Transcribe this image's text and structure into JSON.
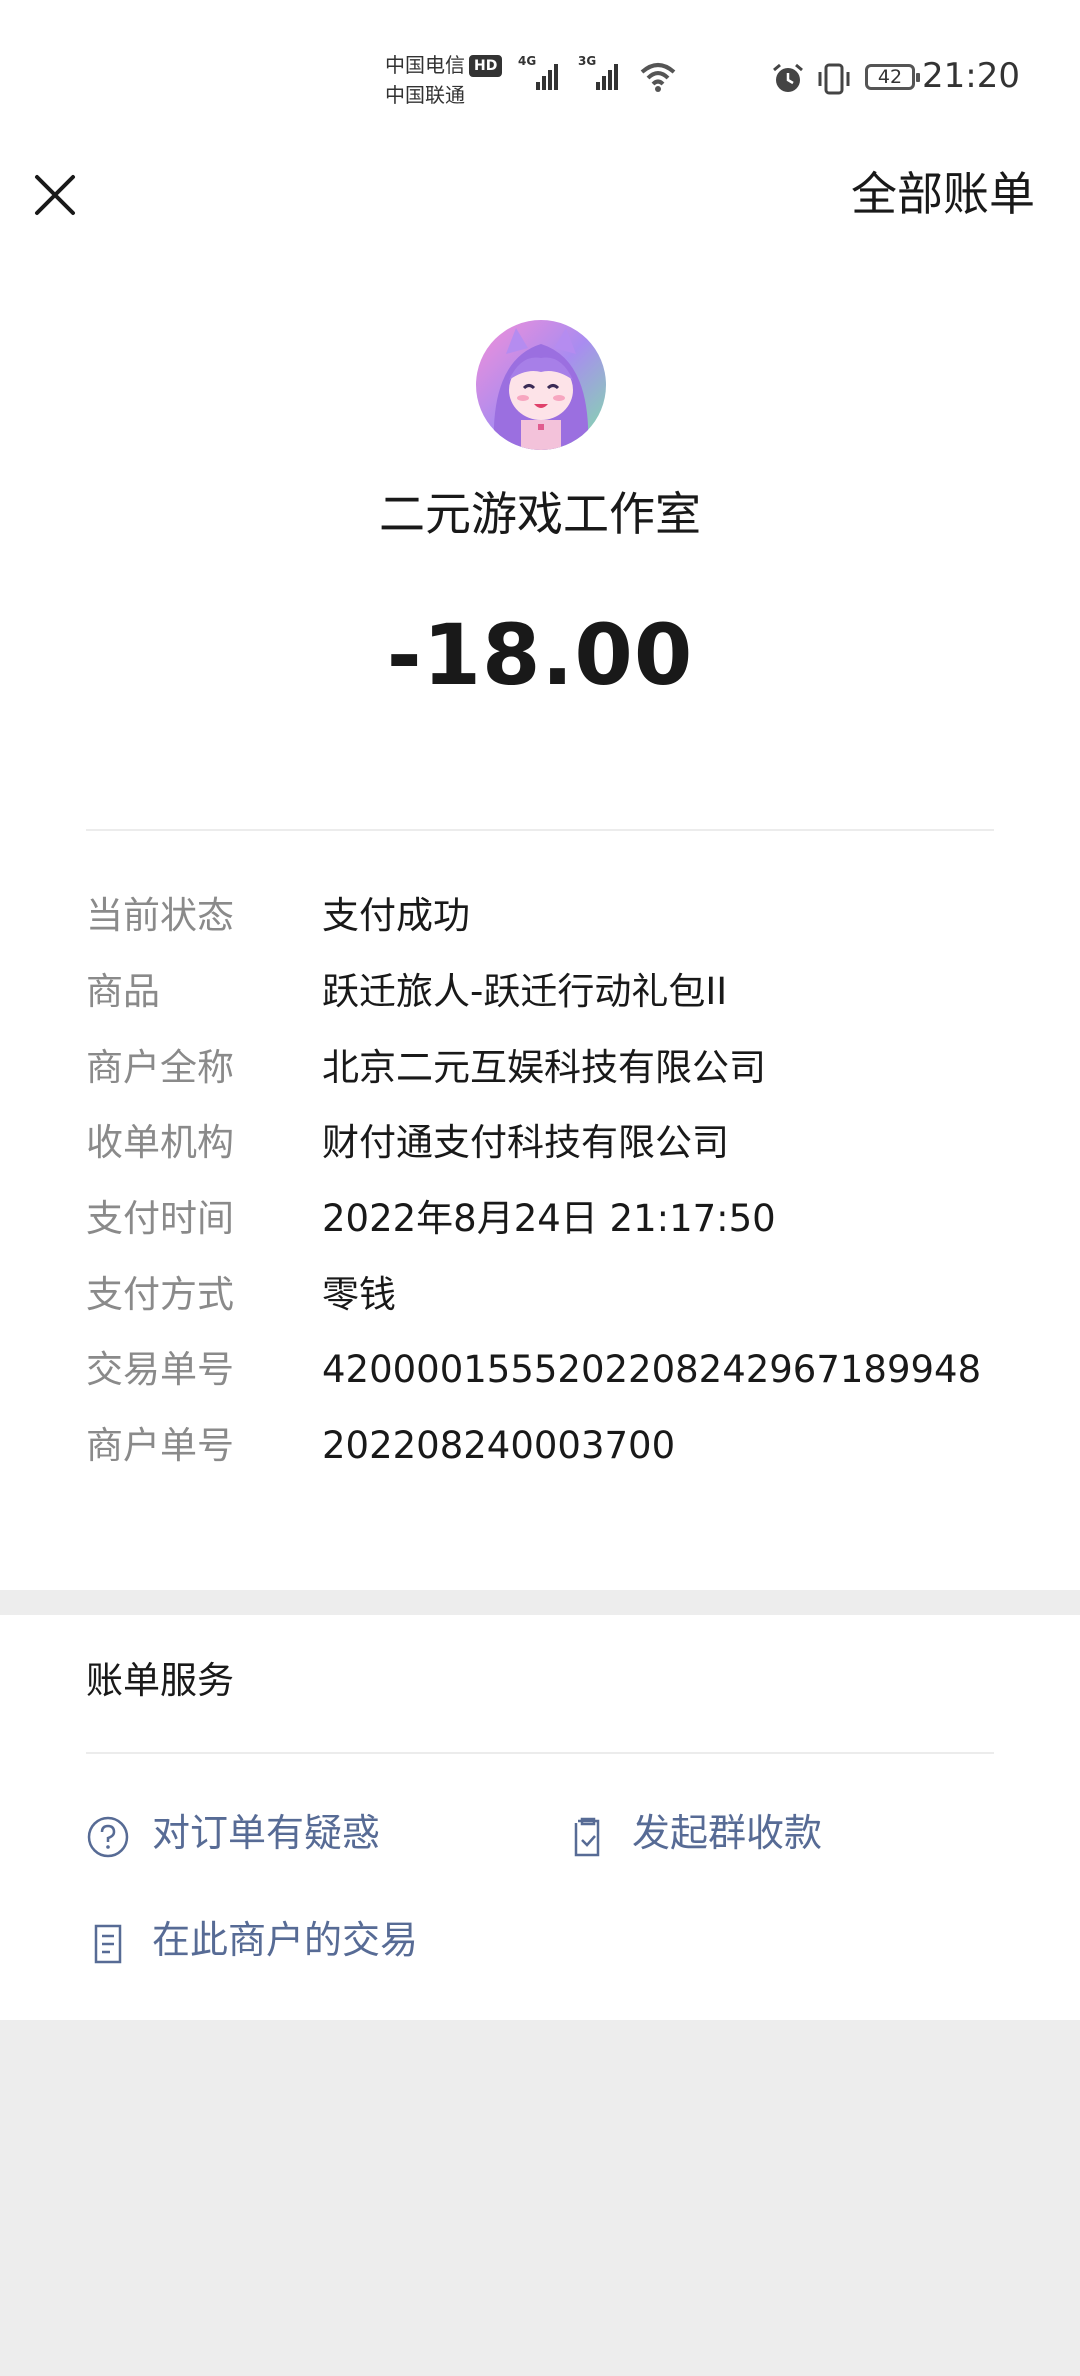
{
  "status_bar": {
    "carrier_1": "中国电信",
    "hd_badge": "HD",
    "carrier_2": "中国联通",
    "network_1": "4G",
    "network_2": "3G",
    "battery_level": "42",
    "time": "21:20"
  },
  "nav": {
    "title": "全部账单"
  },
  "merchant": {
    "name": "二元游戏工作室",
    "amount": "-18.00"
  },
  "details": [
    {
      "label": "当前状态",
      "value": "支付成功"
    },
    {
      "label": "商品",
      "value": "跃迁旅人-跃迁行动礼包II"
    },
    {
      "label": "商户全称",
      "value": "北京二元互娱科技有限公司"
    },
    {
      "label": "收单机构",
      "value": "财付通支付科技有限公司"
    },
    {
      "label": "支付时间",
      "value": "2022年8月24日 21:17:50"
    },
    {
      "label": "支付方式",
      "value": "零钱"
    },
    {
      "label": "交易单号",
      "value": "4200001555202208242967189948"
    },
    {
      "label": "商户单号",
      "value": "202208240003700"
    }
  ],
  "services": {
    "title": "账单服务",
    "question": "对订单有疑惑",
    "group_collect": "发起群收款",
    "merchant_trades": "在此商户的交易"
  },
  "colors": {
    "link": "#576b95",
    "label_gray": "#8a8a8a",
    "background": "#ededed"
  }
}
